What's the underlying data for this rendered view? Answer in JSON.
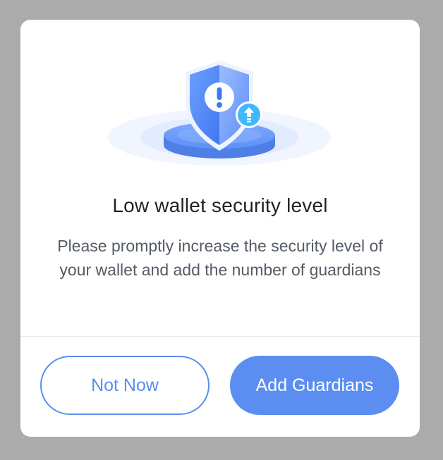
{
  "dialog": {
    "title": "Low wallet security level",
    "message": "Please promptly increase the security level of your wallet and add the number of guardians",
    "illustration_icon": "shield-alert-icon",
    "badge_icon": "upload-arrow-icon"
  },
  "actions": {
    "secondary_label": "Not Now",
    "primary_label": "Add Guardians"
  },
  "colors": {
    "overlay": "#ababab",
    "accent": "#5b8ef0",
    "badge": "#3fb8ff",
    "title": "#1f2329",
    "body_text": "#555b66"
  }
}
